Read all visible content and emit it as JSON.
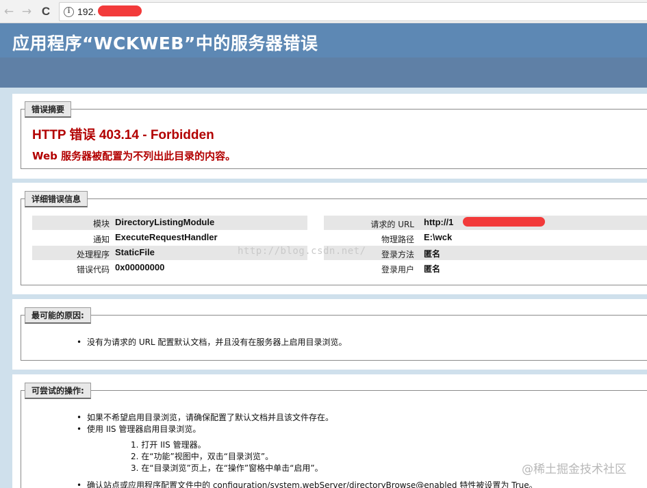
{
  "browser": {
    "back_glyph": "←",
    "forward_glyph": "→",
    "reload_glyph": "C",
    "info_glyph": "i",
    "url_visible": "192."
  },
  "header": {
    "title": "应用程序“WCKWEB”中的服务器错误"
  },
  "summary": {
    "legend": "错误摘要",
    "title": "HTTP 错误 403.14 - Forbidden",
    "message": "Web 服务器被配置为不列出此目录的内容。"
  },
  "details": {
    "legend": "详细错误信息",
    "left": [
      {
        "label": "模块",
        "value": "DirectoryListingModule"
      },
      {
        "label": "通知",
        "value": "ExecuteRequestHandler"
      },
      {
        "label": "处理程序",
        "value": "StaticFile"
      },
      {
        "label": "错误代码",
        "value": "0x00000000"
      }
    ],
    "right": [
      {
        "label": "请求的 URL",
        "value": "http://1"
      },
      {
        "label": "物理路径",
        "value": "E:\\wck"
      },
      {
        "label": "登录方法",
        "value": "匿名"
      },
      {
        "label": "登录用户",
        "value": "匿名"
      }
    ],
    "watermark": "http://blog.csdn.net/"
  },
  "causes": {
    "legend": "最可能的原因:",
    "items": [
      "没有为请求的 URL 配置默认文档，并且没有在服务器上启用目录浏览。"
    ]
  },
  "actions": {
    "legend": "可尝试的操作:",
    "items": [
      "如果不希望启用目录浏览，请确保配置了默认文档并且该文件存在。",
      "使用 IIS 管理器启用目录浏览。"
    ],
    "steps": [
      "1. 打开 IIS 管理器。",
      "2. 在“功能”视图中，双击“目录浏览”。",
      "3. 在“目录浏览”页上，在“操作”窗格中单击“启用”。"
    ],
    "last_item": "确认站点或应用程序配置文件中的 configuration/system.webServer/directoryBrowse@enabled 特性被设置为 True。"
  },
  "corner_watermark": "@稀土掘金技术社区",
  "colors": {
    "header_bg": "#5d88b4",
    "band_bg": "#5f80a6",
    "error_red": "#b20000",
    "redaction": "#f23a3a"
  }
}
